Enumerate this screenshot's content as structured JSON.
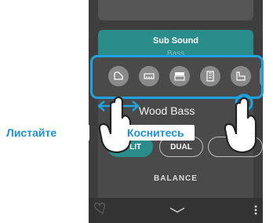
{
  "panel": {
    "sub_sound_title": "Sub Sound",
    "sub_sound_value": "Bass",
    "current_sound": "Wood Bass",
    "modes": [
      "SPLIT",
      "DUAL",
      ""
    ],
    "balance_label": "BALANCE"
  },
  "instrument_icons": [
    "grand-piano-icon",
    "electric-piano-icon",
    "organ-icon",
    "harpsichord-icon",
    "upright-piano-icon"
  ],
  "gesture_labels": {
    "swipe": "Листайте",
    "touch": "Коснитесь"
  },
  "colors": {
    "accent_teal": "#2a8c8b",
    "highlight_blue": "#1fa3e0",
    "label_blue": "#1e90dc"
  }
}
